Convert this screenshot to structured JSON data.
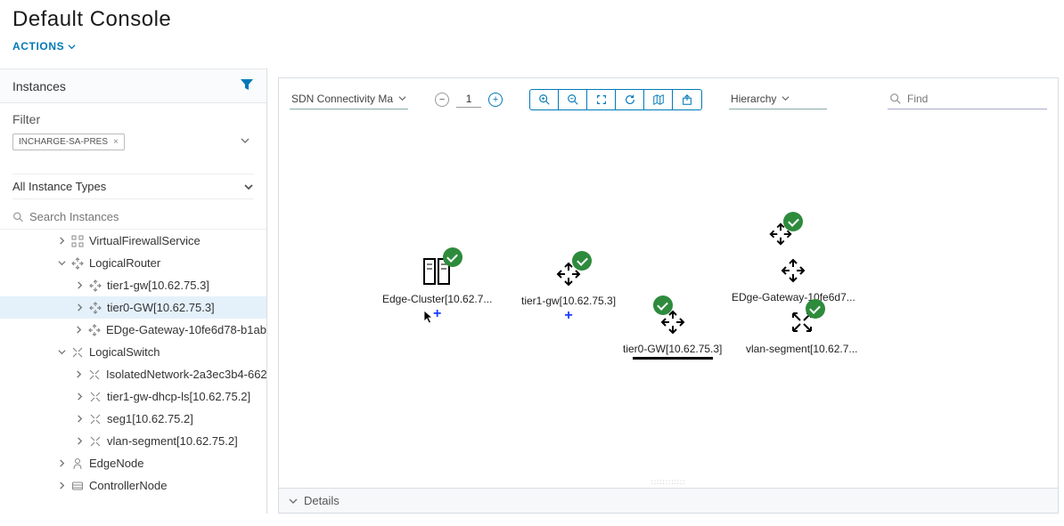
{
  "title": "Default Console",
  "actions_label": "ACTIONS",
  "sidebar": {
    "instances_header": "Instances",
    "filter_label": "Filter",
    "filter_chip": "INCHARGE-SA-PRES",
    "type_selector": "All Instance Types",
    "search_placeholder": "Search Instances",
    "tree": [
      {
        "label": "VirtualFirewallService",
        "depth": 0,
        "caret": ">",
        "icon": "grid"
      },
      {
        "label": "LogicalRouter",
        "depth": 0,
        "caret": "v",
        "icon": "router",
        "expanded": true
      },
      {
        "label": "tier1-gw[10.62.75.3]",
        "depth": 1,
        "caret": ">",
        "icon": "router"
      },
      {
        "label": "tier0-GW[10.62.75.3]",
        "depth": 1,
        "caret": ">",
        "icon": "router",
        "selected": true
      },
      {
        "label": "EDge-Gateway-10fe6d78-b1ab-",
        "depth": 1,
        "caret": ">",
        "icon": "router"
      },
      {
        "label": "LogicalSwitch",
        "depth": 0,
        "caret": "v",
        "icon": "switch",
        "expanded": true
      },
      {
        "label": "IsolatedNetwork-2a3ec3b4-662",
        "depth": 1,
        "caret": ">",
        "icon": "switch"
      },
      {
        "label": "tier1-gw-dhcp-ls[10.62.75.2]",
        "depth": 1,
        "caret": ">",
        "icon": "switch"
      },
      {
        "label": "seg1[10.62.75.2]",
        "depth": 1,
        "caret": ">",
        "icon": "switch"
      },
      {
        "label": "vlan-segment[10.62.75.2]",
        "depth": 1,
        "caret": ">",
        "icon": "switch"
      },
      {
        "label": "EdgeNode",
        "depth": 0,
        "caret": ">",
        "icon": "node"
      },
      {
        "label": "ControllerNode",
        "depth": 0,
        "caret": ">",
        "icon": "controller"
      }
    ]
  },
  "toolbar": {
    "view_dropdown": "SDN Connectivity Ma",
    "zoom_value": "1",
    "layout_dropdown": "Hierarchy",
    "find_placeholder": "Find"
  },
  "topology": {
    "nodes": {
      "edgecluster": "Edge-Cluster[10.62.7...",
      "tier1gw": "tier1-gw[10.62.75.3]",
      "tier0gw": "tier0-GW[10.62.75.3]",
      "edgegw": "EDge-Gateway-10fe6d7...",
      "vlanseg": "vlan-segment[10.62.7...",
      "top_solo": ""
    }
  },
  "details_label": "Details"
}
